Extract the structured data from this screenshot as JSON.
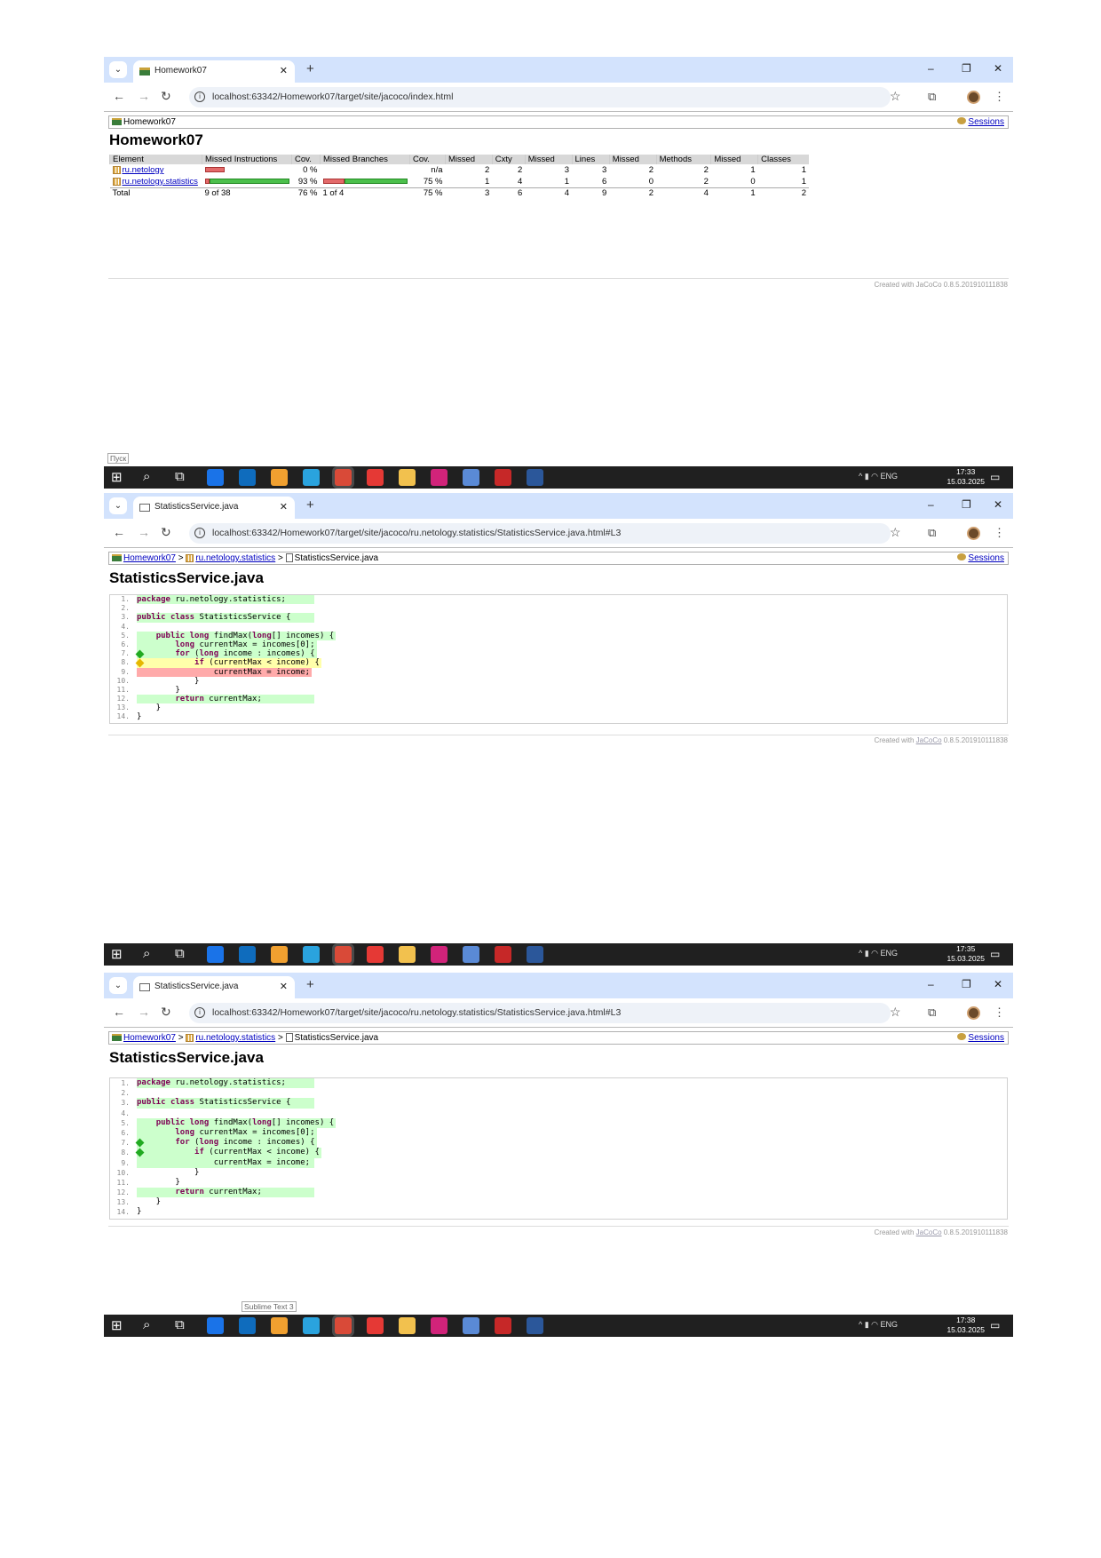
{
  "browser": {
    "new_tab": "+",
    "minimize": "–",
    "restore": "❐",
    "close": "✕",
    "tab_close": "✕",
    "back": "←",
    "forward": "→",
    "reload": "↻",
    "info": "i",
    "star": "☆",
    "extensions": "⧉",
    "menu": "⋮",
    "tab_menu": "⌄"
  },
  "shot1": {
    "tab_title": "Homework07",
    "url": "localhost:63342/Homework07/target/site/jacoco/index.html",
    "crumb": "Homework07",
    "sessions": "Sessions",
    "title": "Homework07",
    "table": {
      "headers": [
        "Element",
        "Missed Instructions",
        "Cov.",
        "Missed Branches",
        "Cov.",
        "Missed",
        "Cxty",
        "Missed",
        "Lines",
        "Missed",
        "Methods",
        "Missed",
        "Classes"
      ],
      "rows": [
        {
          "name": "ru.netology",
          "ins_cov": "0 %",
          "br_cov": "n/a",
          "v": [
            "2",
            "2",
            "3",
            "3",
            "2",
            "2",
            "1",
            "1"
          ]
        },
        {
          "name": "ru.netology.statistics",
          "ins_cov": "93 %",
          "br_cov": "75 %",
          "v": [
            "1",
            "4",
            "1",
            "6",
            "0",
            "2",
            "0",
            "1"
          ]
        }
      ],
      "total": {
        "name": "Total",
        "ins": "9 of 38",
        "ins_cov": "76 %",
        "br": "1 of 4",
        "br_cov": "75 %",
        "v": [
          "3",
          "6",
          "4",
          "9",
          "2",
          "4",
          "1",
          "2"
        ]
      }
    },
    "footer": "Created with JaCoCo 0.8.5.201910111838",
    "tooltip": "Пуск",
    "clock_time": "17:33",
    "clock_date": "15.03.2025",
    "lang": "ENG"
  },
  "source": {
    "tab_title": "StatisticsService.java",
    "url": "localhost:63342/Homework07/target/site/jacoco/ru.netology.statistics/StatisticsService.java.html#L3",
    "crumb_root": "Homework07",
    "crumb_pkg": "ru.netology.statistics",
    "crumb_file": "StatisticsService.java",
    "sep": ">",
    "sessions": "Sessions",
    "title": "StatisticsService.java",
    "lines": [
      {
        "n": "1.",
        "t": "package ru.netology.statistics;"
      },
      {
        "n": "2.",
        "t": ""
      },
      {
        "n": "3.",
        "t": "public class StatisticsService {"
      },
      {
        "n": "4.",
        "t": ""
      },
      {
        "n": "5.",
        "t": "    public long findMax(long[] incomes) {"
      },
      {
        "n": "6.",
        "t": "        long currentMax = incomes[0];"
      },
      {
        "n": "7.",
        "t": "        for (long income : incomes) {"
      },
      {
        "n": "8.",
        "t": "            if (currentMax < income) {"
      },
      {
        "n": "9.",
        "t": "                currentMax = income;"
      },
      {
        "n": "10.",
        "t": "            }"
      },
      {
        "n": "11.",
        "t": "        }"
      },
      {
        "n": "12.",
        "t": "        return currentMax;"
      },
      {
        "n": "13.",
        "t": "    }"
      },
      {
        "n": "14.",
        "t": "}"
      }
    ],
    "footer_prefix": "Created with ",
    "footer_link": "JaCoCo",
    "footer_suffix": " 0.8.5.201910111838"
  },
  "shot2": {
    "clock_time": "17:35",
    "clock_date": "15.03.2025",
    "lang": "ENG"
  },
  "shot3": {
    "clock_time": "17:38",
    "clock_date": "15.03.2025",
    "lang": "ENG",
    "tooltip": "Sublime Text 3"
  },
  "taskbar": {
    "apps": [
      "start-icon",
      "search-icon",
      "task-view-icon",
      "store-icon",
      "outlook-icon",
      "sublime-icon",
      "telegram-icon",
      "chrome-icon",
      "yandex-icon",
      "explorer-icon",
      "intellij-icon",
      "git-icon",
      "acrobat-icon",
      "word-icon"
    ]
  },
  "colors": {
    "covered": "#ccffcc",
    "partial": "#ffffaa",
    "missed": "#ffaaaa",
    "tab_strip": "#d3e3fd",
    "taskbar": "#202020"
  }
}
